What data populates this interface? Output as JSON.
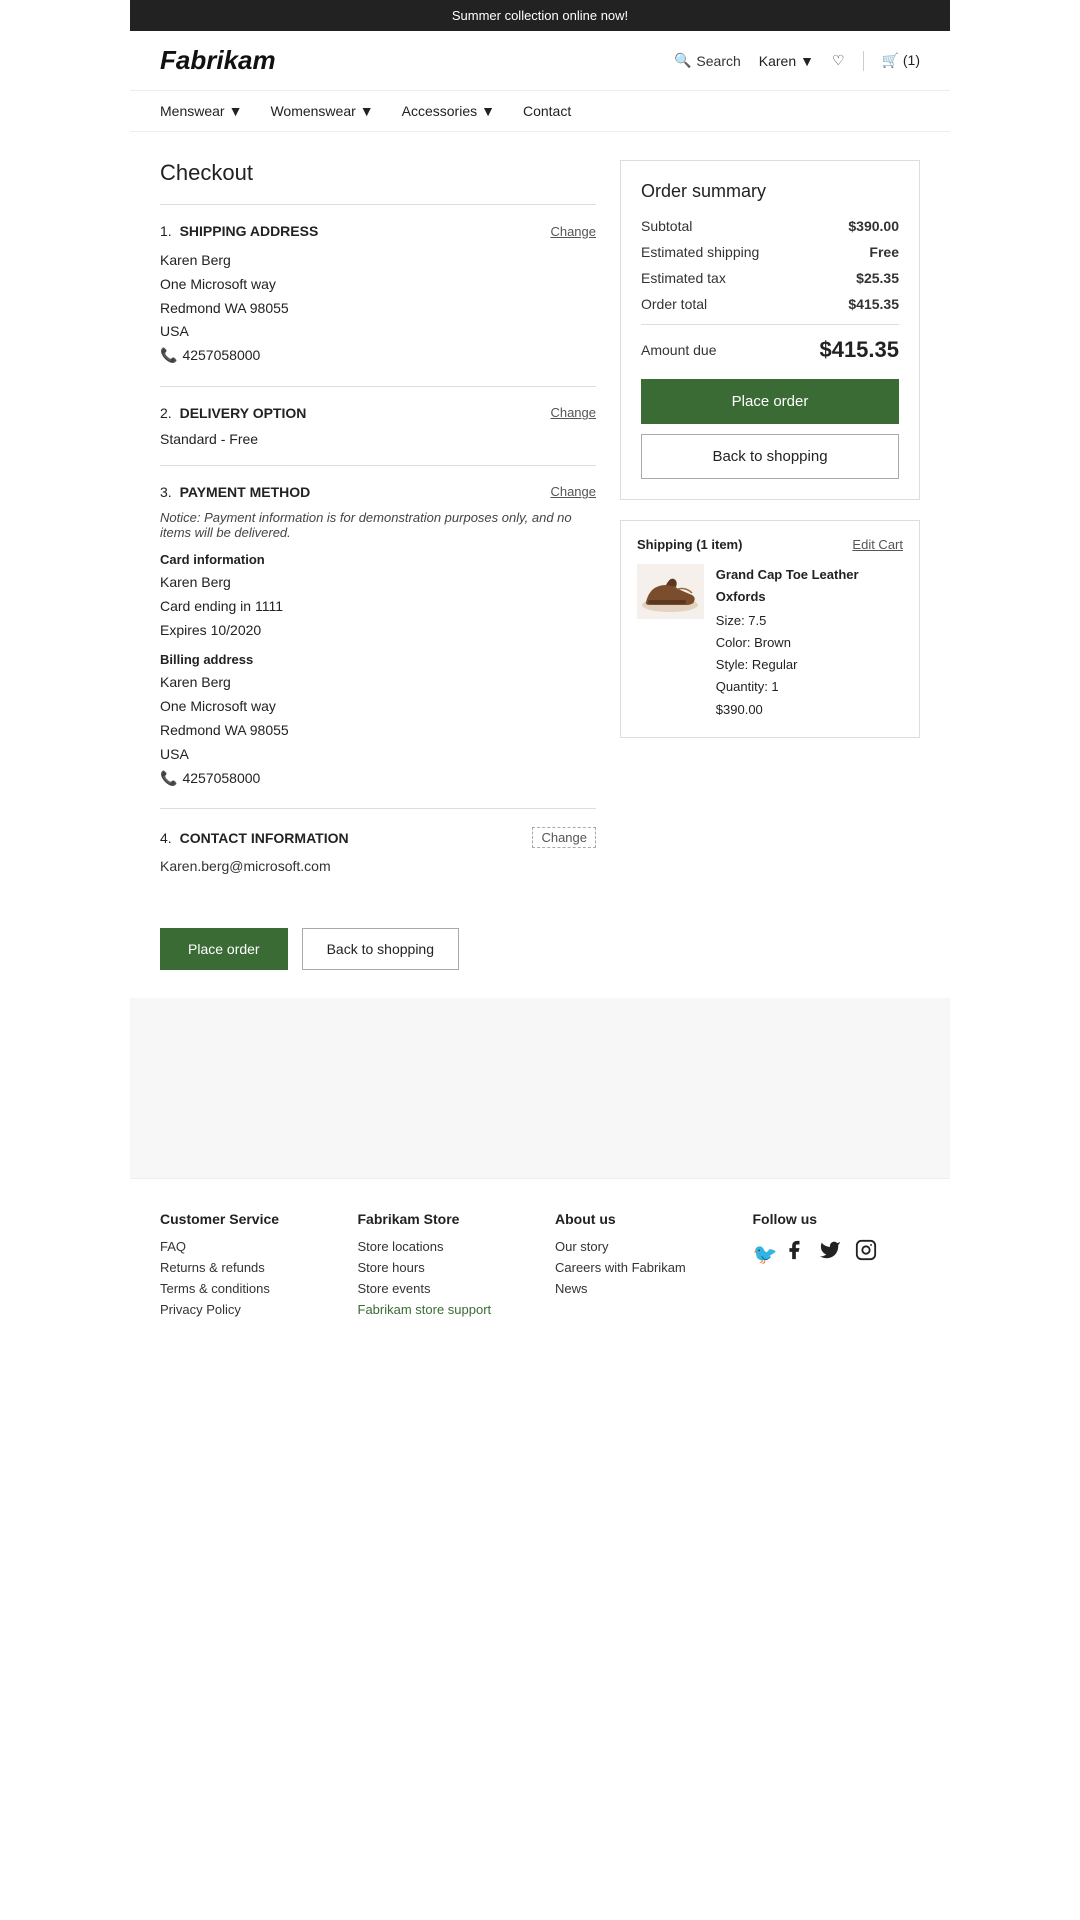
{
  "banner": {
    "text": "Summer collection online now!"
  },
  "header": {
    "logo": "Fabrikam",
    "search_label": "Search",
    "user_name": "Karen",
    "cart_count": "(1)"
  },
  "nav": {
    "items": [
      {
        "label": "Menswear",
        "has_dropdown": true
      },
      {
        "label": "Womenswear",
        "has_dropdown": true
      },
      {
        "label": "Accessories",
        "has_dropdown": true
      },
      {
        "label": "Contact",
        "has_dropdown": false
      }
    ]
  },
  "checkout": {
    "title": "Checkout",
    "sections": {
      "shipping": {
        "step": "1.",
        "title": "SHIPPING ADDRESS",
        "change_label": "Change",
        "name": "Karen Berg",
        "address1": "One Microsoft way",
        "address2": "Redmond WA 98055",
        "country": "USA",
        "phone": "4257058000"
      },
      "delivery": {
        "step": "2.",
        "title": "DELIVERY OPTION",
        "change_label": "Change",
        "option": "Standard -  Free"
      },
      "payment": {
        "step": "3.",
        "title": "PAYMENT METHOD",
        "change_label": "Change",
        "notice": "Notice: Payment information is for demonstration purposes only, and no items will be delivered.",
        "card_info_label": "Card information",
        "card_name": "Karen Berg",
        "card_ending": "Card ending in 1111",
        "card_expires": "Expires 10/2020",
        "billing_label": "Billing address",
        "billing_name": "Karen Berg",
        "billing_address1": "One Microsoft way",
        "billing_address2": "Redmond WA 98055",
        "billing_country": "USA",
        "billing_phone": "4257058000"
      },
      "contact": {
        "step": "4.",
        "title": "CONTACT INFORMATION",
        "change_label": "Change",
        "email": "Karen.berg@microsoft.com"
      }
    },
    "place_order_label": "Place order",
    "back_shopping_label": "Back to shopping"
  },
  "order_summary": {
    "title": "Order summary",
    "subtotal_label": "Subtotal",
    "subtotal_value": "$390.00",
    "shipping_label": "Estimated shipping",
    "shipping_value": "Free",
    "tax_label": "Estimated tax",
    "tax_value": "$25.35",
    "total_label": "Order total",
    "total_value": "$415.35",
    "amount_due_label": "Amount due",
    "amount_due_value": "$415.35",
    "place_order_label": "Place order",
    "back_shopping_label": "Back to shopping"
  },
  "cart": {
    "edit_label": "Edit Cart",
    "shipping_label": "Shipping (1 item)",
    "item": {
      "name": "Grand Cap Toe Leather Oxfords",
      "size": "Size: 7.5",
      "color": "Color: Brown",
      "style": "Style: Regular",
      "quantity": "Quantity: 1",
      "price": "$390.00"
    }
  },
  "footer": {
    "customer_service": {
      "title": "Customer Service",
      "links": [
        "FAQ",
        "Returns & refunds",
        "Terms & conditions",
        "Privacy Policy"
      ]
    },
    "fabrikam_store": {
      "title": "Fabrikam Store",
      "links": [
        "Store locations",
        "Store hours",
        "Store events",
        "Fabrikam store support"
      ]
    },
    "about_us": {
      "title": "About us",
      "links": [
        "Our story",
        "Careers with Fabrikam",
        "News"
      ]
    },
    "follow_us": {
      "title": "Follow us"
    }
  }
}
